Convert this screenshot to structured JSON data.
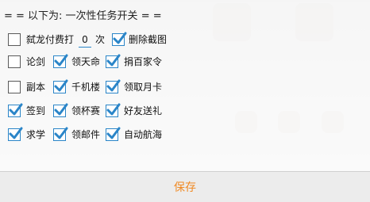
{
  "header": {
    "title": "= = 以下为: 一次性任务开关 = ="
  },
  "rows": [
    [
      {
        "label": "弑龙付费打",
        "checked": false
      },
      {
        "value": "0",
        "suffix": "次"
      },
      {
        "label": "删除截图",
        "checked": true
      }
    ],
    [
      {
        "label": "论剑",
        "checked": false
      },
      {
        "label": "领天命",
        "checked": true
      },
      {
        "label": "捐百家令",
        "checked": true
      }
    ],
    [
      {
        "label": "副本",
        "checked": false
      },
      {
        "label": "千机楼",
        "checked": true
      },
      {
        "label": "领取月卡",
        "checked": true
      }
    ],
    [
      {
        "label": "签到",
        "checked": true
      },
      {
        "label": "领杯赛",
        "checked": true
      },
      {
        "label": "好友送礼",
        "checked": true
      }
    ],
    [
      {
        "label": "求学",
        "checked": true
      },
      {
        "label": "领邮件",
        "checked": true
      },
      {
        "label": "自动航海",
        "checked": true
      }
    ]
  ],
  "footer": {
    "save_label": "保存"
  },
  "colors": {
    "accent": "#2a85c8",
    "save": "#f08a24"
  }
}
